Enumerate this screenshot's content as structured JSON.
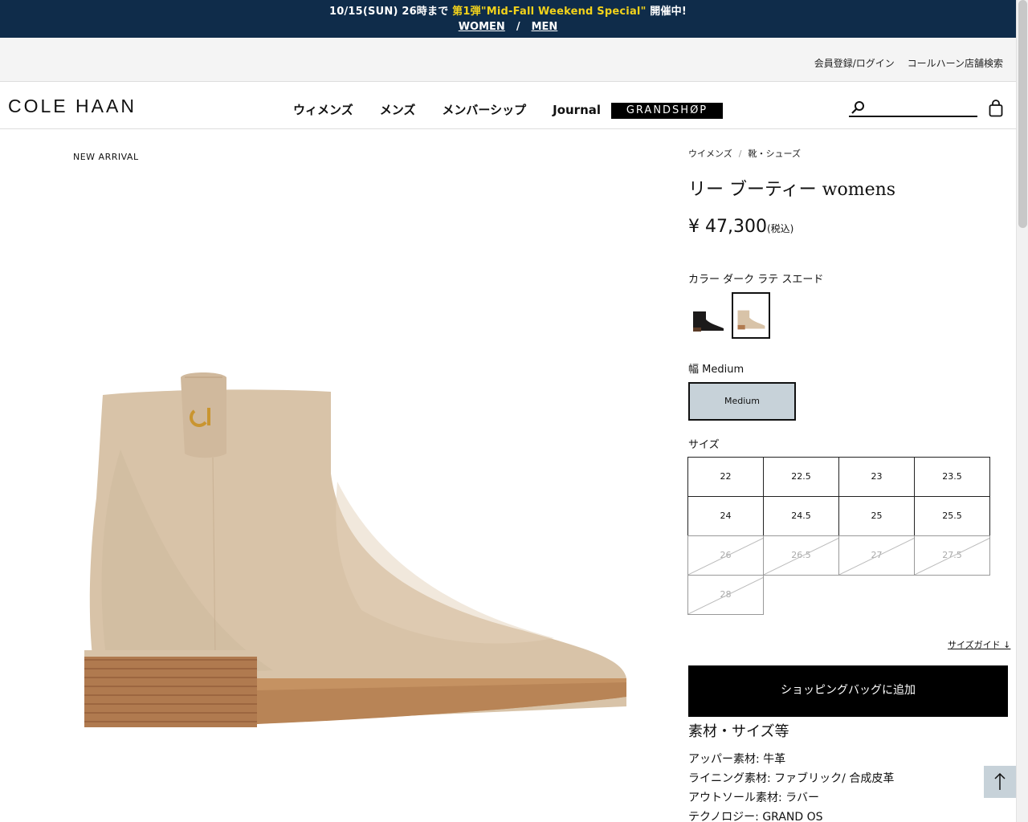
{
  "promo": {
    "prefix": "10/15(SUN) 26時まで ",
    "highlight": "第1弾\"Mid-Fall Weekend Special\"",
    "suffix": " 開催中!",
    "women": "WOMEN",
    "separator": "/",
    "men": "MEN"
  },
  "utility": {
    "login": "会員登録/ログイン",
    "store_search": "コールハーン店舗検索"
  },
  "header": {
    "logo": "COLE HAAN",
    "nav": [
      "ウィメンズ",
      "メンズ",
      "メンバーシップ",
      "Journal"
    ],
    "grandshop": "GRANDSHØP",
    "search_placeholder": ""
  },
  "product": {
    "badge": "NEW ARRIVAL",
    "breadcrumb": [
      "ウイメンズ",
      "靴・シューズ"
    ],
    "breadcrumb_sep": "/",
    "title": "リー ブーティー womens",
    "price": "¥ 47,300",
    "tax_note": "(税込)",
    "color_label": "カラー ダーク ラテ スエード",
    "swatches": [
      {
        "name": "black",
        "selected": false,
        "color": "#1c1a1a"
      },
      {
        "name": "dark-latte-suede",
        "selected": true,
        "color": "#d8c3a8"
      }
    ],
    "width_label": "幅 Medium",
    "width_option": "Medium",
    "size_label": "サイズ",
    "sizes": [
      {
        "label": "22",
        "available": true
      },
      {
        "label": "22.5",
        "available": true
      },
      {
        "label": "23",
        "available": true
      },
      {
        "label": "23.5",
        "available": true
      },
      {
        "label": "24",
        "available": true
      },
      {
        "label": "24.5",
        "available": true
      },
      {
        "label": "25",
        "available": true
      },
      {
        "label": "25.5",
        "available": true
      },
      {
        "label": "26",
        "available": false
      },
      {
        "label": "26.5",
        "available": false
      },
      {
        "label": "27",
        "available": false
      },
      {
        "label": "27.5",
        "available": false
      },
      {
        "label": "28",
        "available": false
      }
    ],
    "size_guide": "サイズガイド ↓",
    "add_to_bag": "ショッピングバッグに追加",
    "spec_title": "素材・サイズ等",
    "specs": [
      "アッパー素材: 牛革",
      "ライニング素材: ファブリック/ 合成皮革",
      "アウトソール素材: ラバー",
      "テクノロジー: GRAND OS"
    ]
  },
  "colors": {
    "promo_bg": "#0f2c4a",
    "promo_highlight": "#f2d21b",
    "boot": "#d8c3a8",
    "heel": "#b07a4f",
    "width_selected": "#c7d2d9"
  }
}
